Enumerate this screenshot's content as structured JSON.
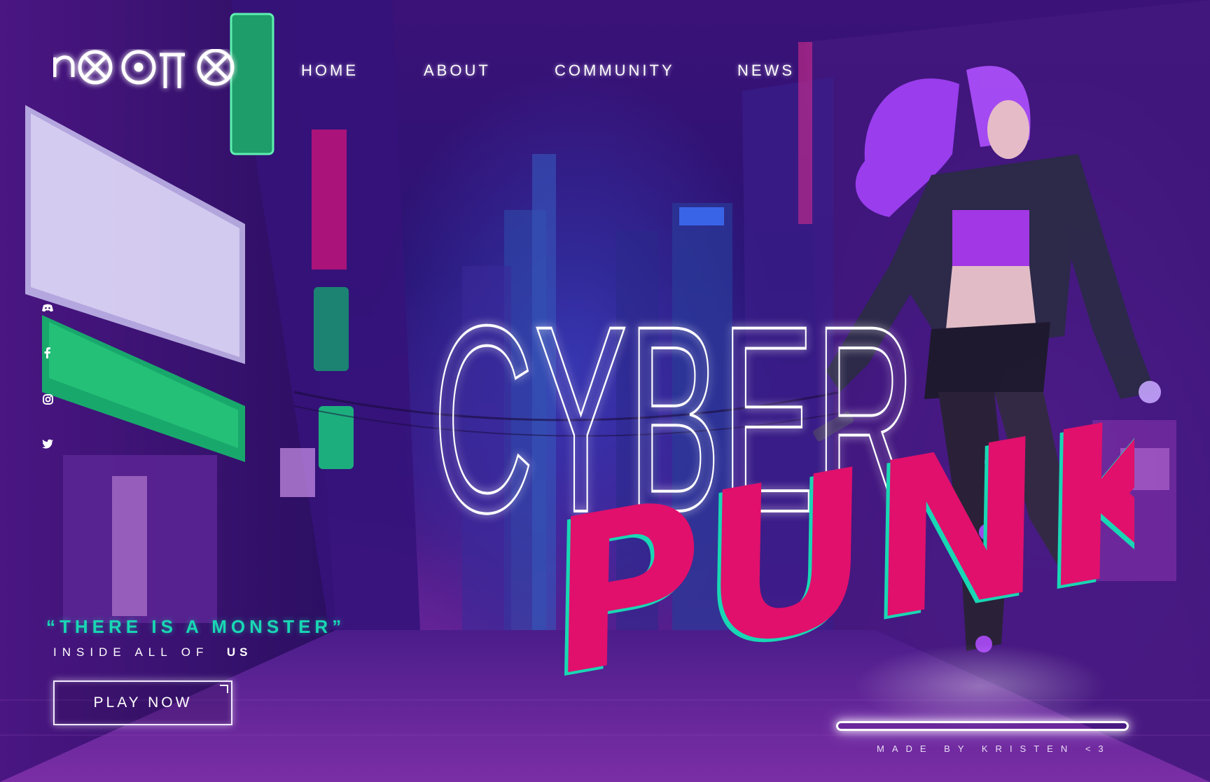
{
  "brand": {
    "logo_text": "nooIIo"
  },
  "nav": {
    "items": [
      {
        "label": "HOME"
      },
      {
        "label": "ABOUT"
      },
      {
        "label": "COMMUNITY"
      },
      {
        "label": "NEWS"
      }
    ]
  },
  "social": [
    {
      "icon": "discord-icon"
    },
    {
      "icon": "facebook-icon"
    },
    {
      "icon": "instagram-icon"
    },
    {
      "icon": "twitter-icon"
    }
  ],
  "hero": {
    "title_outline": "CYBER",
    "title_script": "PUNK",
    "quote": "“THERE IS A MONSTER”",
    "subline_prefix": "INSIDE ALL OF",
    "subline_emphasis": "US",
    "cta_label": "PLAY NOW",
    "credit": "MADE BY KRISTEN <3"
  },
  "colors": {
    "accent_teal": "#19d7b4",
    "accent_pink": "#e0106c",
    "background_purple": "#3b1278",
    "neon_white": "#ffffff"
  }
}
